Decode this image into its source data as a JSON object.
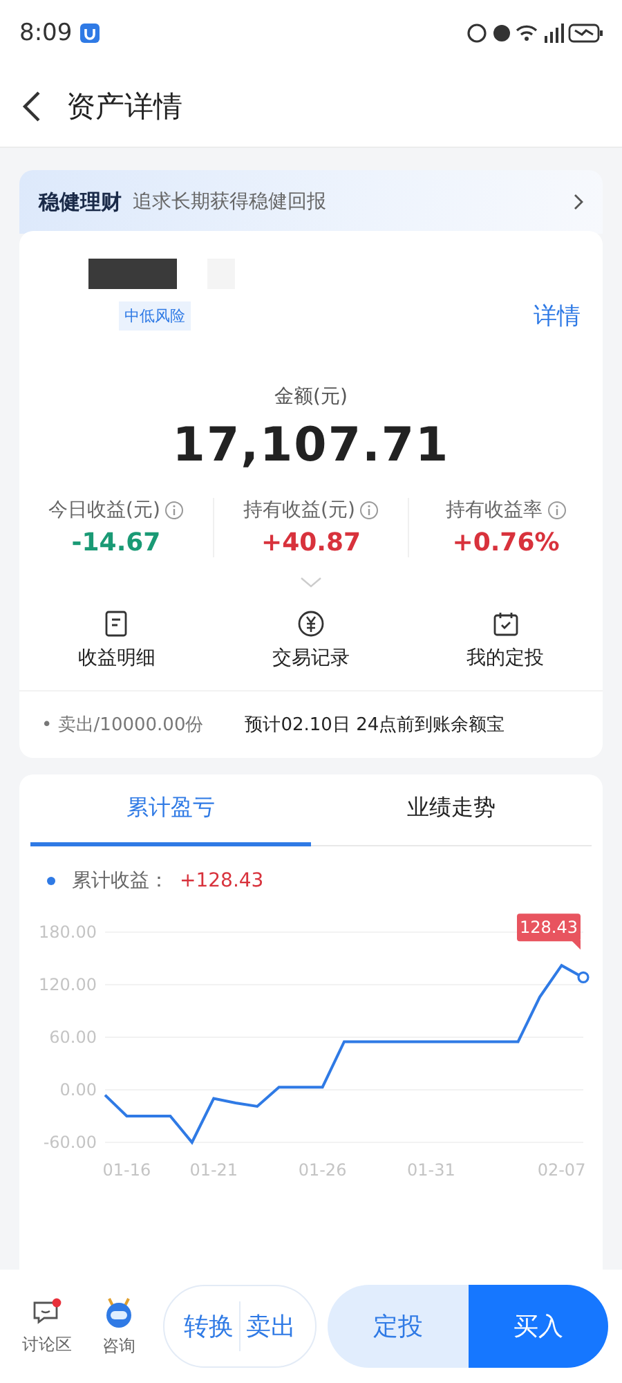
{
  "status_bar": {
    "time": "8:09"
  },
  "header": {
    "title": "资产详情"
  },
  "banner": {
    "title": "稳健理财",
    "subtitle": "追求长期获得稳健回报"
  },
  "fund": {
    "risk_tag": "中低风险",
    "detail_link": "详情",
    "amount_label": "金额(元)",
    "amount": "17,107.71"
  },
  "metrics": [
    {
      "label": "今日收益(元)",
      "value": "-14.67",
      "color": "#1a9a75"
    },
    {
      "label": "持有收益(元)",
      "value": "+40.87",
      "color": "#d8323c"
    },
    {
      "label": "持有收益率",
      "value": "+0.76%",
      "color": "#d8323c"
    }
  ],
  "actions": [
    {
      "kind": "doc",
      "label": "收益明细"
    },
    {
      "kind": "yen",
      "label": "交易记录"
    },
    {
      "kind": "calendar",
      "label": "我的定投"
    }
  ],
  "notice": {
    "bullet": "•",
    "action": "卖出/10000.00份",
    "text": "预计02.10日 24点前到账余额宝"
  },
  "chart_tabs": [
    {
      "label": "累计盈亏",
      "selected": true
    },
    {
      "label": "业绩走势",
      "selected": false
    }
  ],
  "legend": {
    "separator": "：",
    "value": "+128.43"
  },
  "chart_data": {
    "type": "line",
    "categories": [
      null,
      "01-16",
      null,
      null,
      null,
      "01-21",
      null,
      null,
      null,
      null,
      "01-26",
      null,
      null,
      null,
      null,
      "01-31",
      null,
      null,
      null,
      null,
      null,
      "02-07",
      null
    ],
    "ylim": [
      -60,
      180
    ],
    "series": [
      {
        "name": "累计收益",
        "color": "#2f7ae5",
        "values": [
          -6,
          -30,
          -30,
          -30,
          -60,
          -10,
          -15,
          -19,
          3,
          3,
          3,
          55,
          55,
          55,
          55,
          55,
          55,
          55,
          55,
          55,
          106,
          142,
          128
        ]
      }
    ],
    "yticks": [
      {
        "value": -60,
        "label": "-60.00"
      },
      {
        "value": 0,
        "label": "0.00"
      },
      {
        "value": 60,
        "label": "60.00"
      },
      {
        "value": 120,
        "label": "120.00"
      },
      {
        "value": 180,
        "label": "180.00"
      }
    ],
    "grid": true,
    "annotations": [
      {
        "y": 128.43,
        "text": "128.43"
      }
    ]
  },
  "bottom_bar": {
    "discuss": {
      "label": "讨论区",
      "unread": true
    },
    "consult": {
      "label": "咨询"
    },
    "convert": "转换",
    "sell": "卖出",
    "auto_invest": "定投",
    "buy": "买入"
  }
}
